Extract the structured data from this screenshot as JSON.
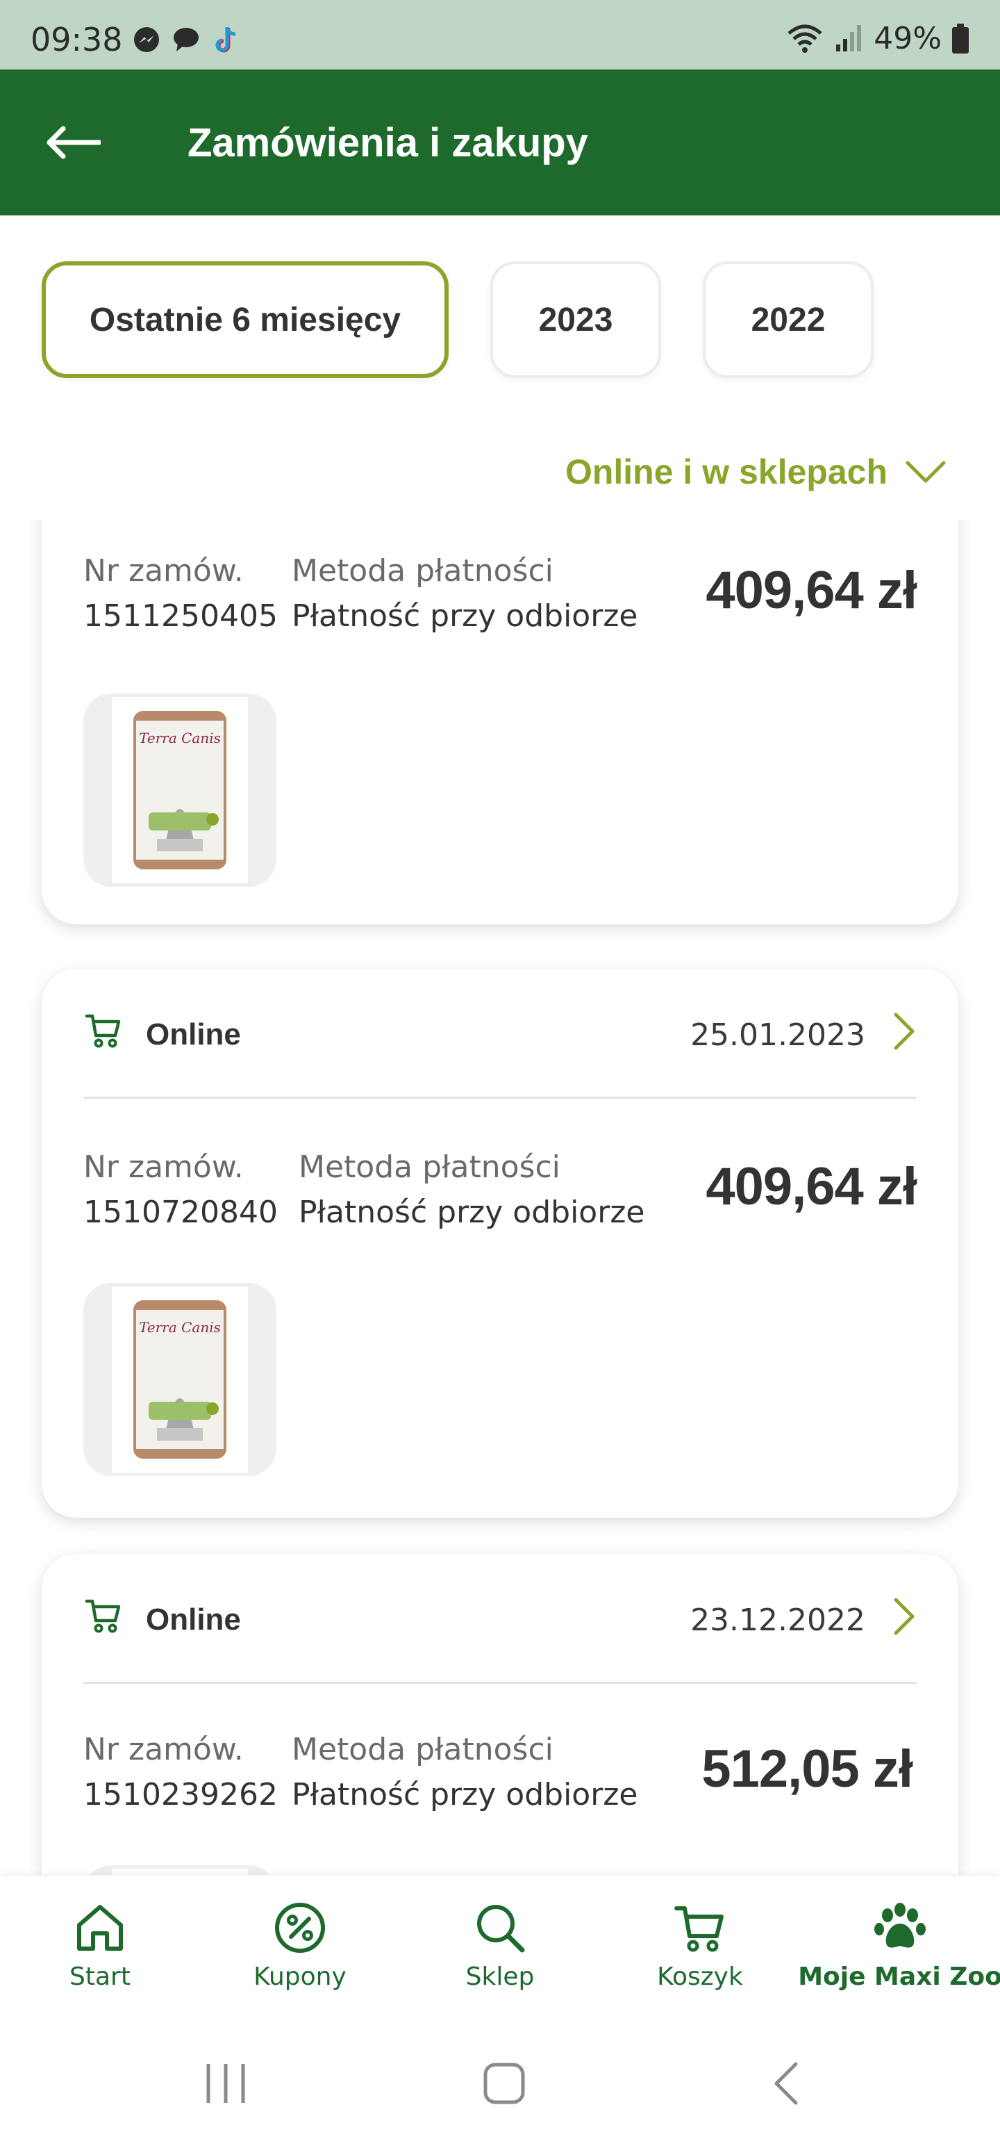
{
  "status_bar": {
    "time": "09:38",
    "battery": "49%"
  },
  "header": {
    "title": "Zamówienia i zakupy"
  },
  "filters": [
    {
      "label": "Ostatnie 6 miesięcy",
      "active": true
    },
    {
      "label": "2023",
      "active": false
    },
    {
      "label": "2022",
      "active": false
    }
  ],
  "source_filter": {
    "label": "Online i w sklepach"
  },
  "orders": [
    {
      "type": "",
      "date": "",
      "order_no_label": "Nr zamów.",
      "order_no": "1511250405",
      "payment_label": "Metoda płatności",
      "payment": "Płatność przy odbiorze",
      "amount": "409,64 zł",
      "product_brand": "Terra Canis"
    },
    {
      "type": "Online",
      "date": "25.01.2023",
      "order_no_label": "Nr zamów.",
      "order_no": "1510720840",
      "payment_label": "Metoda płatności",
      "payment": "Płatność przy odbiorze",
      "amount": "409,64 zł",
      "product_brand": "Terra Canis"
    },
    {
      "type": "Online",
      "date": "23.12.2022",
      "order_no_label": "Nr zamów.",
      "order_no": "1510239262",
      "payment_label": "Metoda płatności",
      "payment": "Płatność przy odbiorze",
      "amount": "512,05 zł",
      "product_brand": ""
    }
  ],
  "bottom_nav": [
    {
      "label": "Start",
      "icon": "home-icon",
      "active": false
    },
    {
      "label": "Kupony",
      "icon": "percent-coupon-icon",
      "active": false
    },
    {
      "label": "Sklep",
      "icon": "search-icon",
      "active": false
    },
    {
      "label": "Koszyk",
      "icon": "cart-icon",
      "active": false
    },
    {
      "label": "Moje Maxi Zoo",
      "icon": "paw-icon",
      "active": true
    }
  ],
  "colors": {
    "brand_green": "#1e6a2d",
    "accent_olive": "#8aa62a",
    "status_bar": "#bfd6c5"
  }
}
